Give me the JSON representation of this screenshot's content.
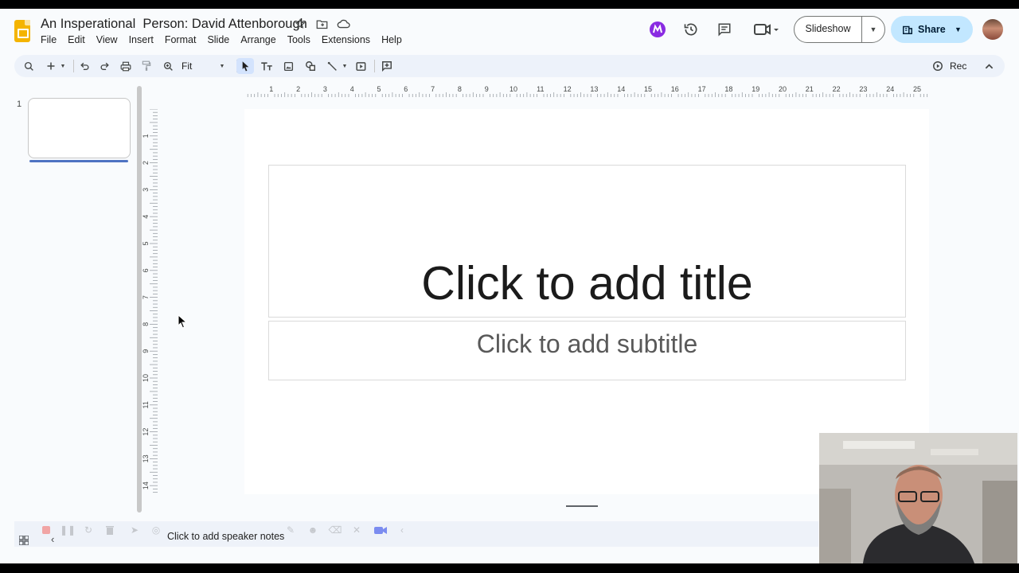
{
  "header": {
    "doc_title": "An Insperational  Person: David Attenborough",
    "menu": [
      "File",
      "Edit",
      "View",
      "Insert",
      "Format",
      "Slide",
      "Arrange",
      "Tools",
      "Extensions",
      "Help"
    ],
    "slideshow_label": "Slideshow",
    "share_label": "Share",
    "colors": {
      "accent_share": "#c2e7ff",
      "logo": "#f4b400"
    }
  },
  "toolbar": {
    "zoom_value": "Fit",
    "rec_label": "Rec",
    "icons": [
      "search-icon",
      "new-slide-icon",
      "undo-icon",
      "redo-icon",
      "print-icon",
      "paint-format-icon",
      "zoom-icon",
      "select-icon",
      "text-box-icon",
      "image-icon",
      "shape-icon",
      "line-icon",
      "video-icon",
      "comment-icon"
    ]
  },
  "rulers": {
    "horizontal_labels": [
      "1",
      "2",
      "3",
      "4",
      "5",
      "6",
      "7",
      "8",
      "9",
      "10",
      "11",
      "12",
      "13",
      "14",
      "15",
      "16",
      "17",
      "18",
      "19",
      "20",
      "21",
      "22",
      "23",
      "24",
      "25"
    ],
    "vertical_labels": [
      "1",
      "2",
      "3",
      "4",
      "5",
      "6",
      "7",
      "8",
      "9",
      "10",
      "11",
      "12",
      "13",
      "14"
    ]
  },
  "filmstrip": {
    "slide_number": "1"
  },
  "slide": {
    "title_placeholder": "Click to add title",
    "subtitle_placeholder": "Click to add subtitle"
  },
  "notes": {
    "placeholder": "Click to add speaker notes"
  }
}
